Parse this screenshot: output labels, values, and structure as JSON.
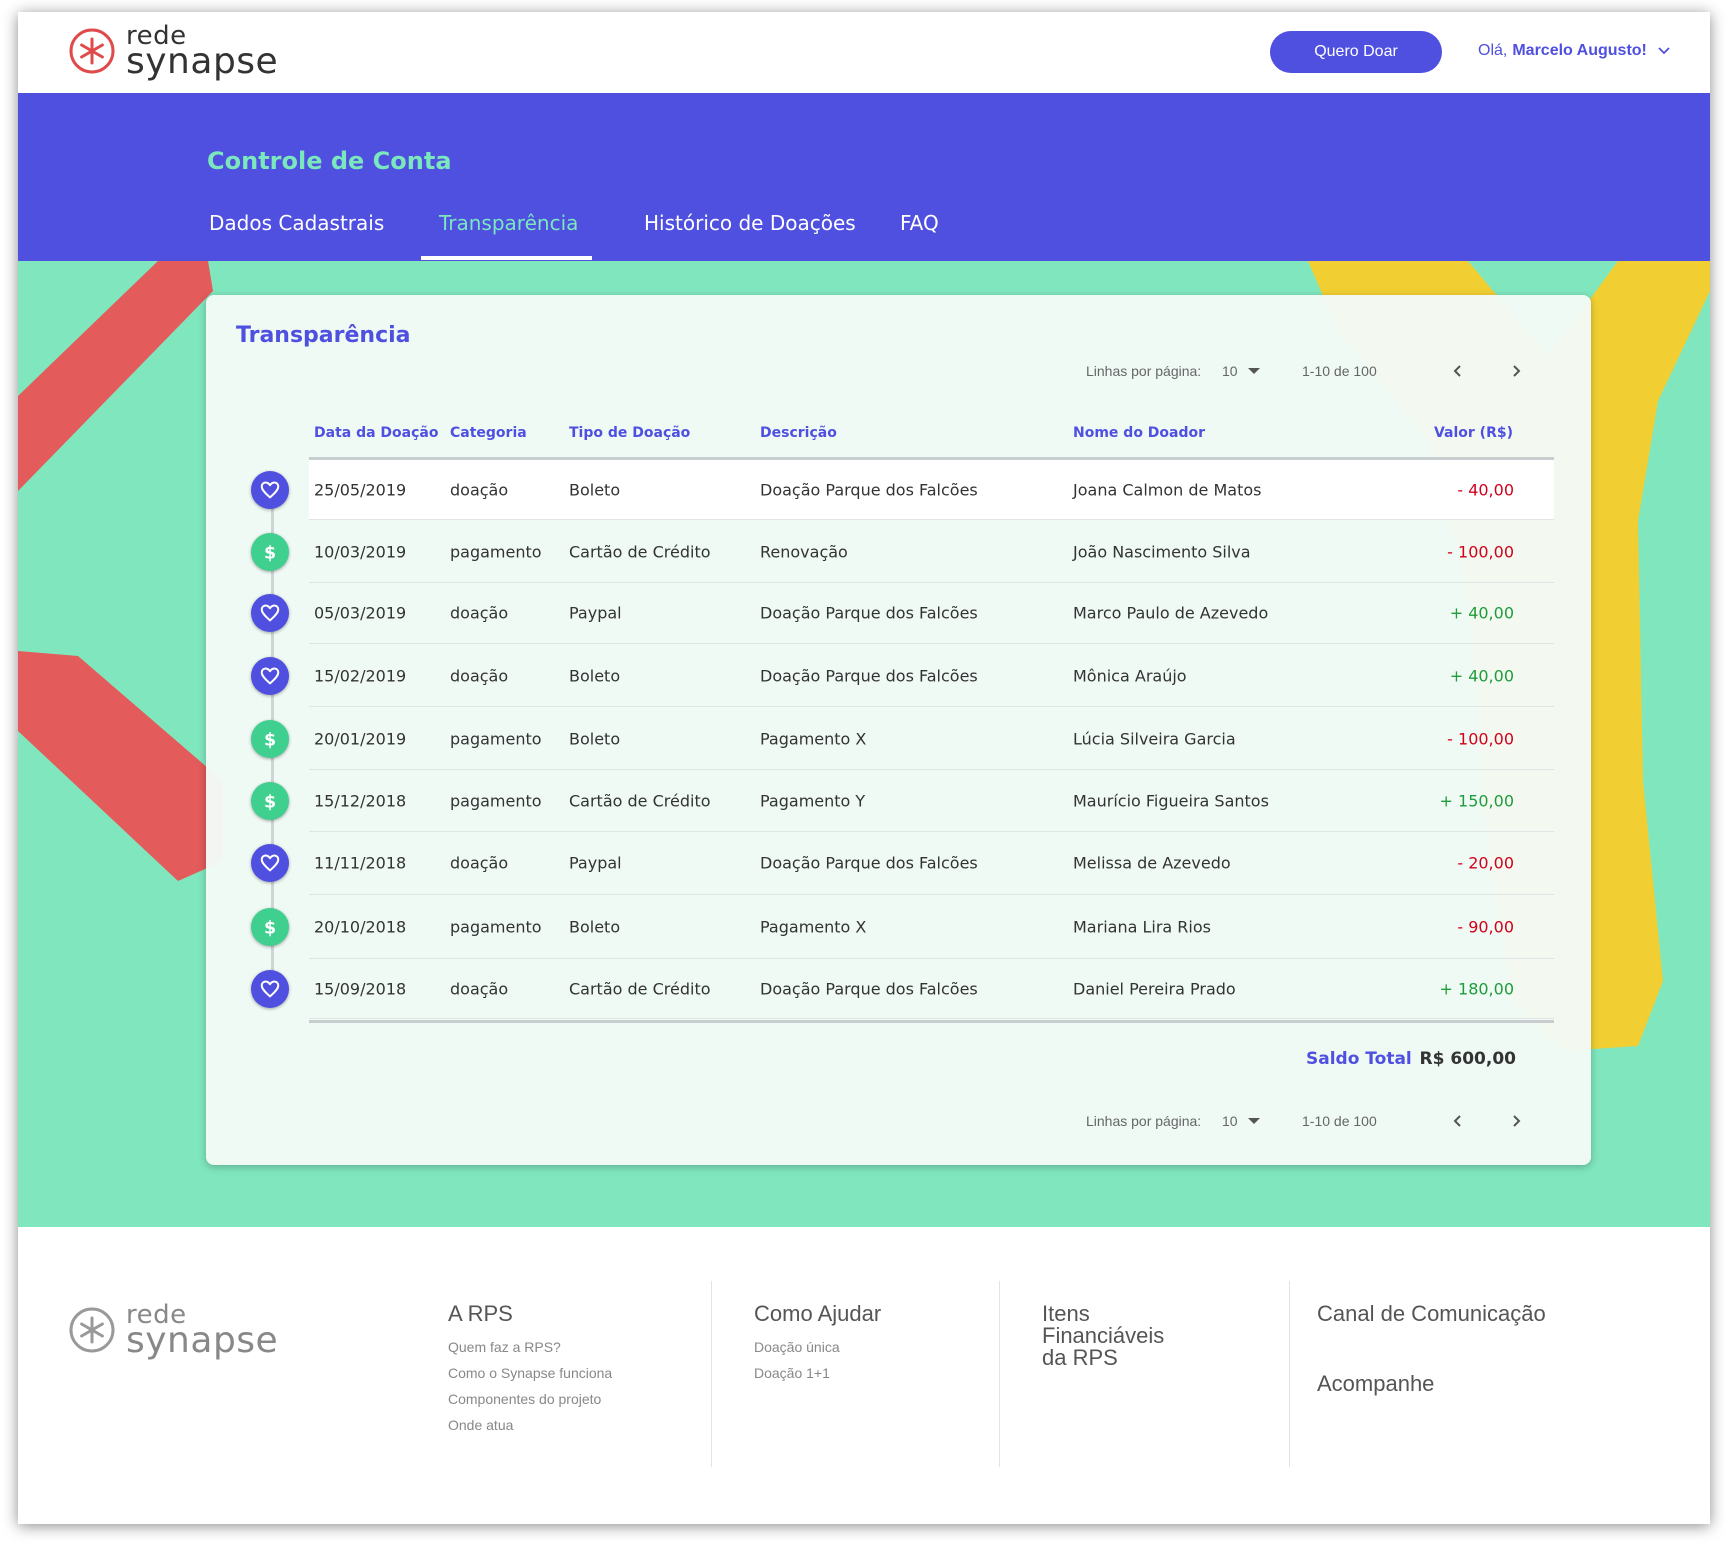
{
  "header": {
    "logo": {
      "line1": "rede",
      "line2": "synapse"
    },
    "donate_button": "Quero Doar",
    "greeting": "Olá,",
    "user_name": "Marcelo Augusto!"
  },
  "banner": {
    "title": "Controle de Conta",
    "tabs": [
      {
        "label": "Dados Cadastrais"
      },
      {
        "label": "Transparência",
        "active": true
      },
      {
        "label": "Histórico de Doações"
      },
      {
        "label": "FAQ"
      }
    ]
  },
  "card": {
    "title": "Transparência",
    "pagination": {
      "rows_label": "Linhas por página:",
      "rows_value": "10",
      "range": "1-10 de 100"
    },
    "columns": [
      "Data da Doação",
      "Categoria",
      "Tipo de Doação",
      "Descrição",
      "Nome do Doador",
      "Valor (R$)"
    ],
    "rows": [
      {
        "icon": "heart-icon",
        "date": "25/05/2019",
        "category": "doação",
        "type": "Boleto",
        "description": "Doação Parque dos Falcões",
        "donor": "Joana Calmon de Matos",
        "value": "- 40,00",
        "sign": "neg"
      },
      {
        "icon": "dollar-icon",
        "date": "10/03/2019",
        "category": "pagamento",
        "type": "Cartão de Crédito",
        "description": "Renovação",
        "donor": "João Nascimento Silva",
        "value": "- 100,00",
        "sign": "neg"
      },
      {
        "icon": "heart-icon",
        "date": "05/03/2019",
        "category": "doação",
        "type": "Paypal",
        "description": "Doação Parque dos Falcões",
        "donor": "Marco Paulo de Azevedo",
        "value": "+ 40,00",
        "sign": "pos"
      },
      {
        "icon": "heart-icon",
        "date": "15/02/2019",
        "category": "doação",
        "type": "Boleto",
        "description": "Doação Parque dos Falcões",
        "donor": "Mônica Araújo",
        "value": "+ 40,00",
        "sign": "pos"
      },
      {
        "icon": "dollar-icon",
        "date": "20/01/2019",
        "category": "pagamento",
        "type": "Boleto",
        "description": "Pagamento X",
        "donor": "Lúcia Silveira Garcia",
        "value": "- 100,00",
        "sign": "neg"
      },
      {
        "icon": "dollar-icon",
        "date": "15/12/2018",
        "category": "pagamento",
        "type": "Cartão de Crédito",
        "description": "Pagamento Y",
        "donor": "Maurício Figueira Santos",
        "value": "+ 150,00",
        "sign": "pos"
      },
      {
        "icon": "heart-icon",
        "date": "11/11/2018",
        "category": "doação",
        "type": "Paypal",
        "description": "Doação Parque dos Falcões",
        "donor": "Melissa de Azevedo",
        "value": "- 20,00",
        "sign": "neg"
      },
      {
        "icon": "dollar-icon",
        "date": "20/10/2018",
        "category": "pagamento",
        "type": "Boleto",
        "description": "Pagamento X",
        "donor": "Mariana Lira Rios",
        "value": "- 90,00",
        "sign": "neg"
      },
      {
        "icon": "heart-icon",
        "date": "15/09/2018",
        "category": "doação",
        "type": "Cartão de Crédito",
        "description": "Doação Parque dos Falcões",
        "donor": "Daniel Pereira Prado",
        "value": "+ 180,00",
        "sign": "pos"
      }
    ],
    "total_label": "Saldo Total",
    "total_value": "R$ 600,00"
  },
  "footer": {
    "logo": {
      "line1": "rede",
      "line2": "synapse"
    },
    "columns": [
      {
        "title": "A RPS",
        "links": [
          "Quem faz a RPS?",
          "Como o Synapse funciona",
          "Componentes do projeto",
          "Onde atua"
        ]
      },
      {
        "title": "Como Ajudar",
        "links": [
          "Doação única",
          "Doação 1+1"
        ]
      },
      {
        "title": "Itens Financiáveis da RPS",
        "links": []
      },
      {
        "title": "Canal de Comunicação",
        "links": [],
        "extra": "Acompanhe"
      }
    ]
  },
  "colors": {
    "brand_purple": "#4f4fe0",
    "accent_green": "#7ae7bd",
    "background_green": "#7fe6be",
    "negative_red": "#d0021b",
    "positive_green": "#1f9d3a"
  }
}
